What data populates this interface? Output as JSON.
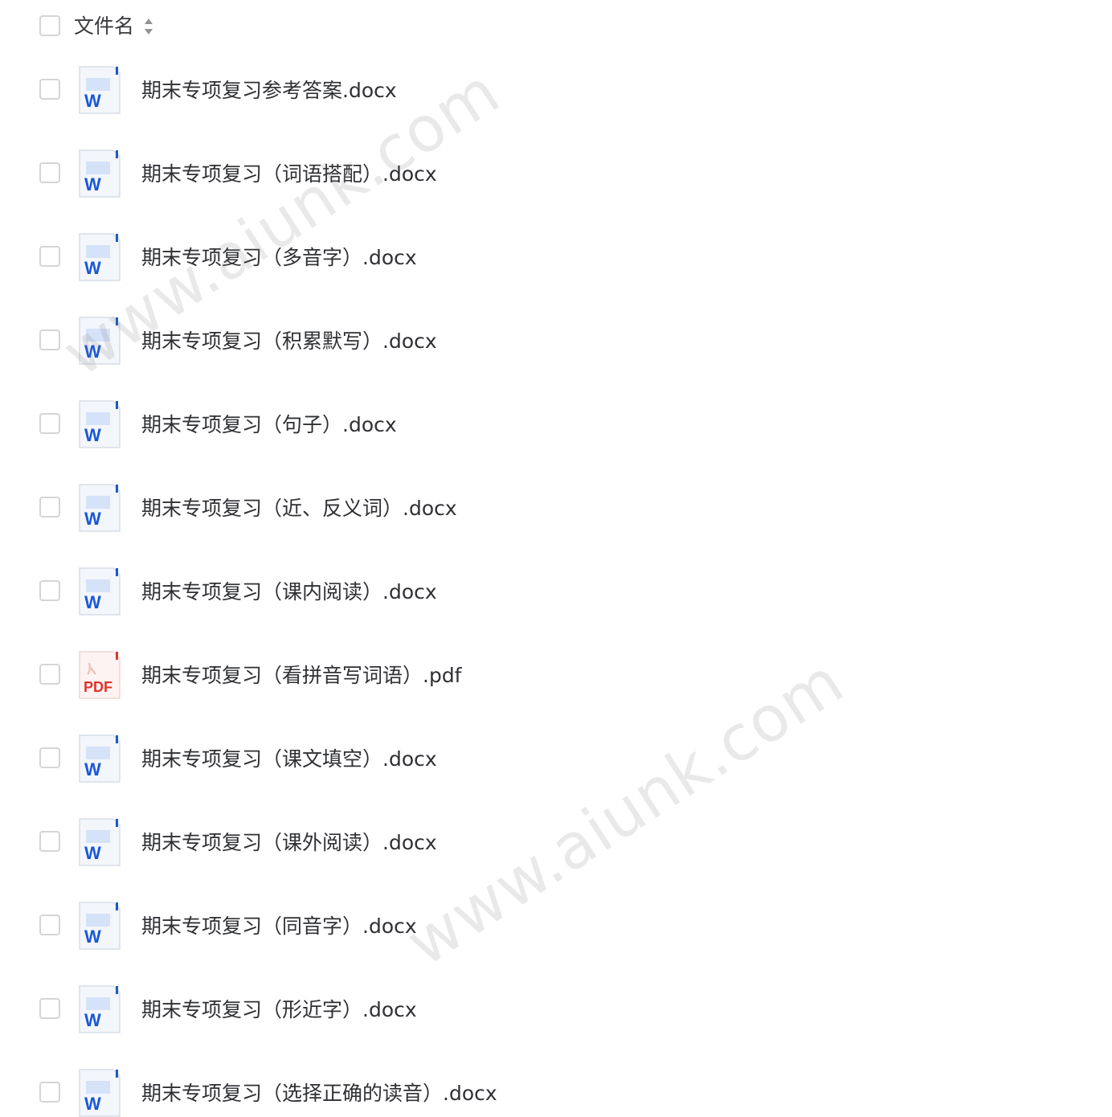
{
  "header": {
    "column_label": "文件名",
    "sort_icon": "sort-icon"
  },
  "files": [
    {
      "name": "期末专项复习参考答案.docx",
      "type": "docx",
      "icon": "word-icon"
    },
    {
      "name": "期末专项复习（词语搭配）.docx",
      "type": "docx",
      "icon": "word-icon"
    },
    {
      "name": "期末专项复习（多音字）.docx",
      "type": "docx",
      "icon": "word-icon"
    },
    {
      "name": "期末专项复习（积累默写）.docx",
      "type": "docx",
      "icon": "word-icon"
    },
    {
      "name": "期末专项复习（句子）.docx",
      "type": "docx",
      "icon": "word-icon"
    },
    {
      "name": "期末专项复习（近、反义词）.docx",
      "type": "docx",
      "icon": "word-icon"
    },
    {
      "name": "期末专项复习（课内阅读）.docx",
      "type": "docx",
      "icon": "word-icon"
    },
    {
      "name": "期末专项复习（看拼音写词语）.pdf",
      "type": "pdf",
      "icon": "pdf-icon"
    },
    {
      "name": "期末专项复习（课文填空）.docx",
      "type": "docx",
      "icon": "word-icon"
    },
    {
      "name": "期末专项复习（课外阅读）.docx",
      "type": "docx",
      "icon": "word-icon"
    },
    {
      "name": "期末专项复习（同音字）.docx",
      "type": "docx",
      "icon": "word-icon"
    },
    {
      "name": "期末专项复习（形近字）.docx",
      "type": "docx",
      "icon": "word-icon"
    },
    {
      "name": "期末专项复习（选择正确的读音）.docx",
      "type": "docx",
      "icon": "word-icon"
    }
  ],
  "icon_labels": {
    "word": "W",
    "pdf": "PDF"
  },
  "watermark": "www.aiunk.com",
  "colors": {
    "word_blue": "#1a57d6",
    "pdf_red": "#e0352b",
    "checkbox_border": "#d3d5da",
    "text": "#2f3034"
  }
}
